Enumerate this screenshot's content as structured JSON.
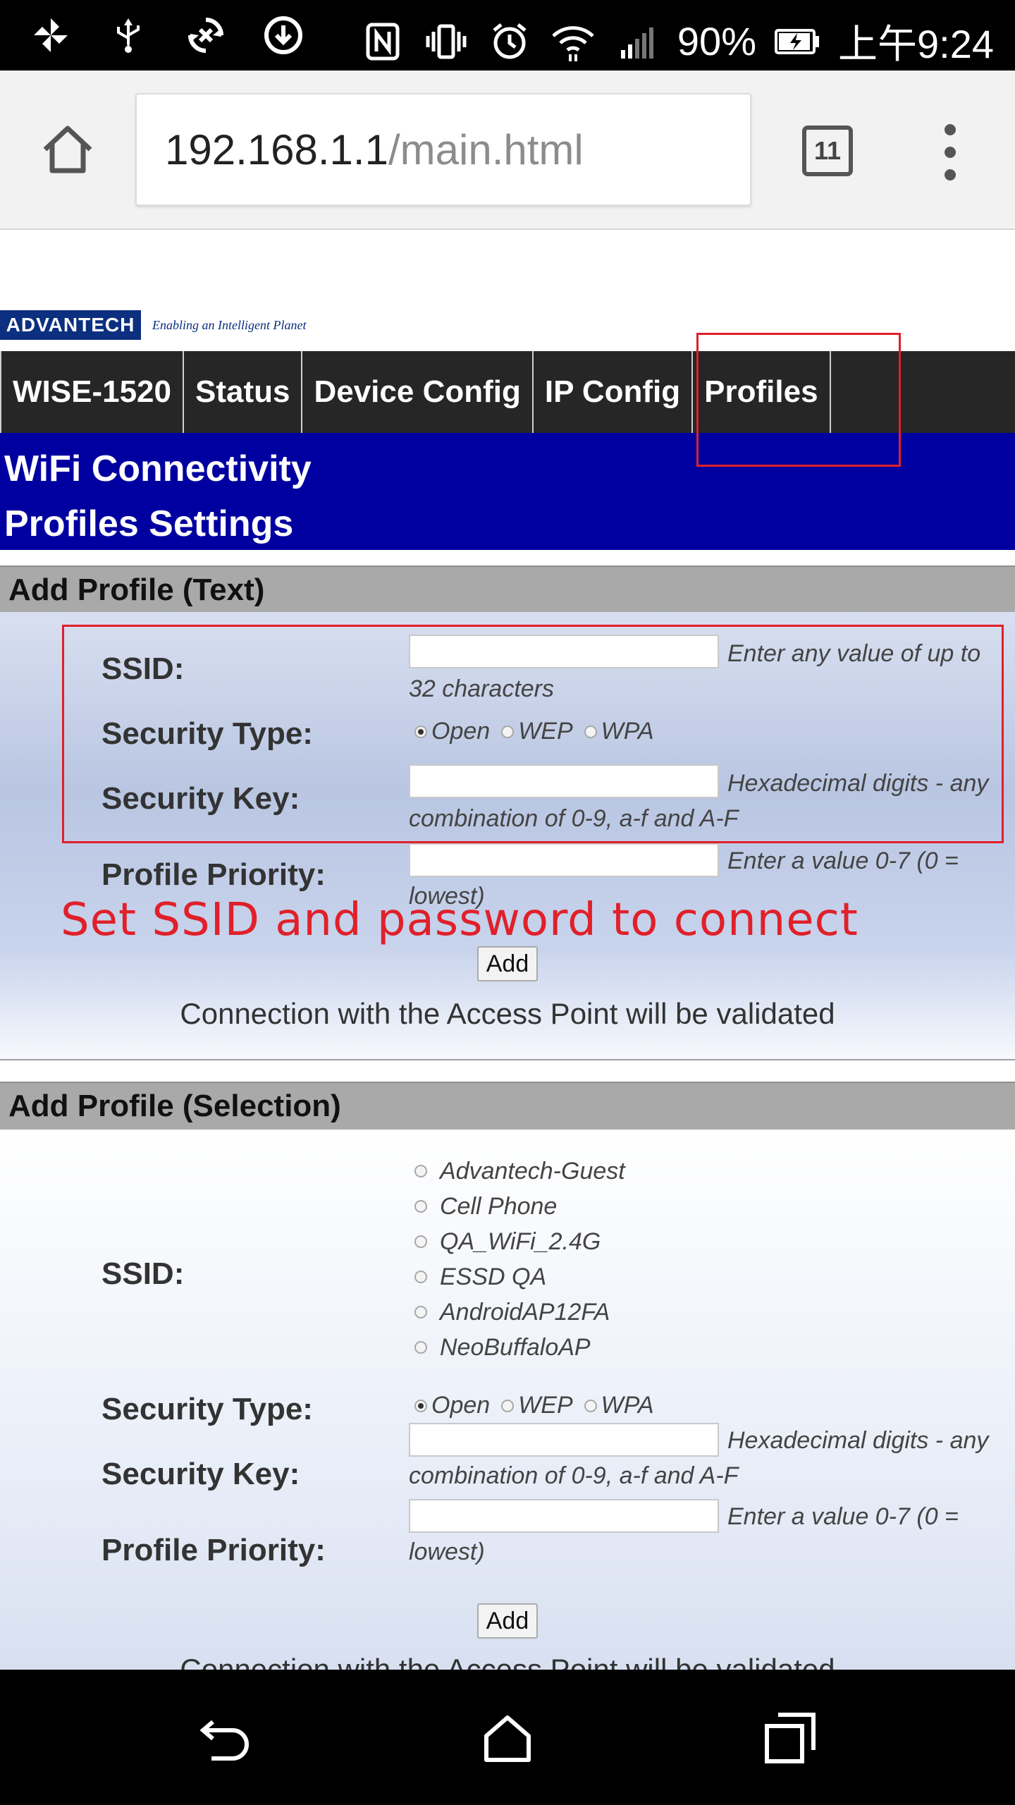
{
  "status_bar": {
    "battery": "90%",
    "time": "上午9:24",
    "icons": [
      "pinwheel-icon",
      "usb-icon",
      "sync-icon",
      "download-icon",
      "nfc-icon",
      "vibrate-icon",
      "alarm-icon",
      "wifi-icon",
      "signal-icon",
      "battery-charging-icon"
    ]
  },
  "browser": {
    "url_host": "192.168.1.1",
    "url_path": "/main.html",
    "tab_count": "11"
  },
  "logo": {
    "brand": "ADVANTECH",
    "slogan": "Enabling an Intelligent Planet"
  },
  "nav": {
    "items": [
      "WISE-1520",
      "Status",
      "Device Config",
      "IP Config",
      "Profiles"
    ]
  },
  "banner": {
    "line1": "WiFi Connectivity",
    "line2": "Profiles Settings"
  },
  "add_text": {
    "header": "Add Profile (Text)",
    "ssid_label": "SSID:",
    "ssid_hint": "Enter any value of up to 32 characters",
    "security_type_label": "Security Type:",
    "security_options": [
      "Open",
      "WEP",
      "WPA"
    ],
    "security_selected": "Open",
    "security_key_label": "Security Key:",
    "security_key_hint": "Hexadecimal digits - any combination of 0-9, a-f and A-F",
    "priority_label": "Profile Priority:",
    "priority_hint": "Enter a value 0-7 (0 = lowest)",
    "add_button": "Add",
    "note": "Connection with the Access Point will be validated"
  },
  "annotation": "Set SSID and password to connect",
  "add_selection": {
    "header": "Add Profile (Selection)",
    "ssid_label": "SSID:",
    "ssid_options": [
      "Advantech-Guest",
      "Cell Phone",
      "QA_WiFi_2.4G",
      "ESSD QA",
      "AndroidAP12FA",
      "NeoBuffaloAP"
    ],
    "security_type_label": "Security Type:",
    "security_options": [
      "Open",
      "WEP",
      "WPA"
    ],
    "security_selected": "Open",
    "security_key_label": "Security Key:",
    "security_key_hint": "Hexadecimal digits - any combination of 0-9, a-f and A-F",
    "priority_label": "Profile Priority:",
    "priority_hint": "Enter a value 0-7 (0 = lowest)",
    "add_button": "Add",
    "note": "Connection with the Access Point will be validated"
  },
  "colors": {
    "banner": "#0000a0",
    "nav": "#262626",
    "annotation": "#e0202a",
    "section_header": "#a9a9a9"
  }
}
